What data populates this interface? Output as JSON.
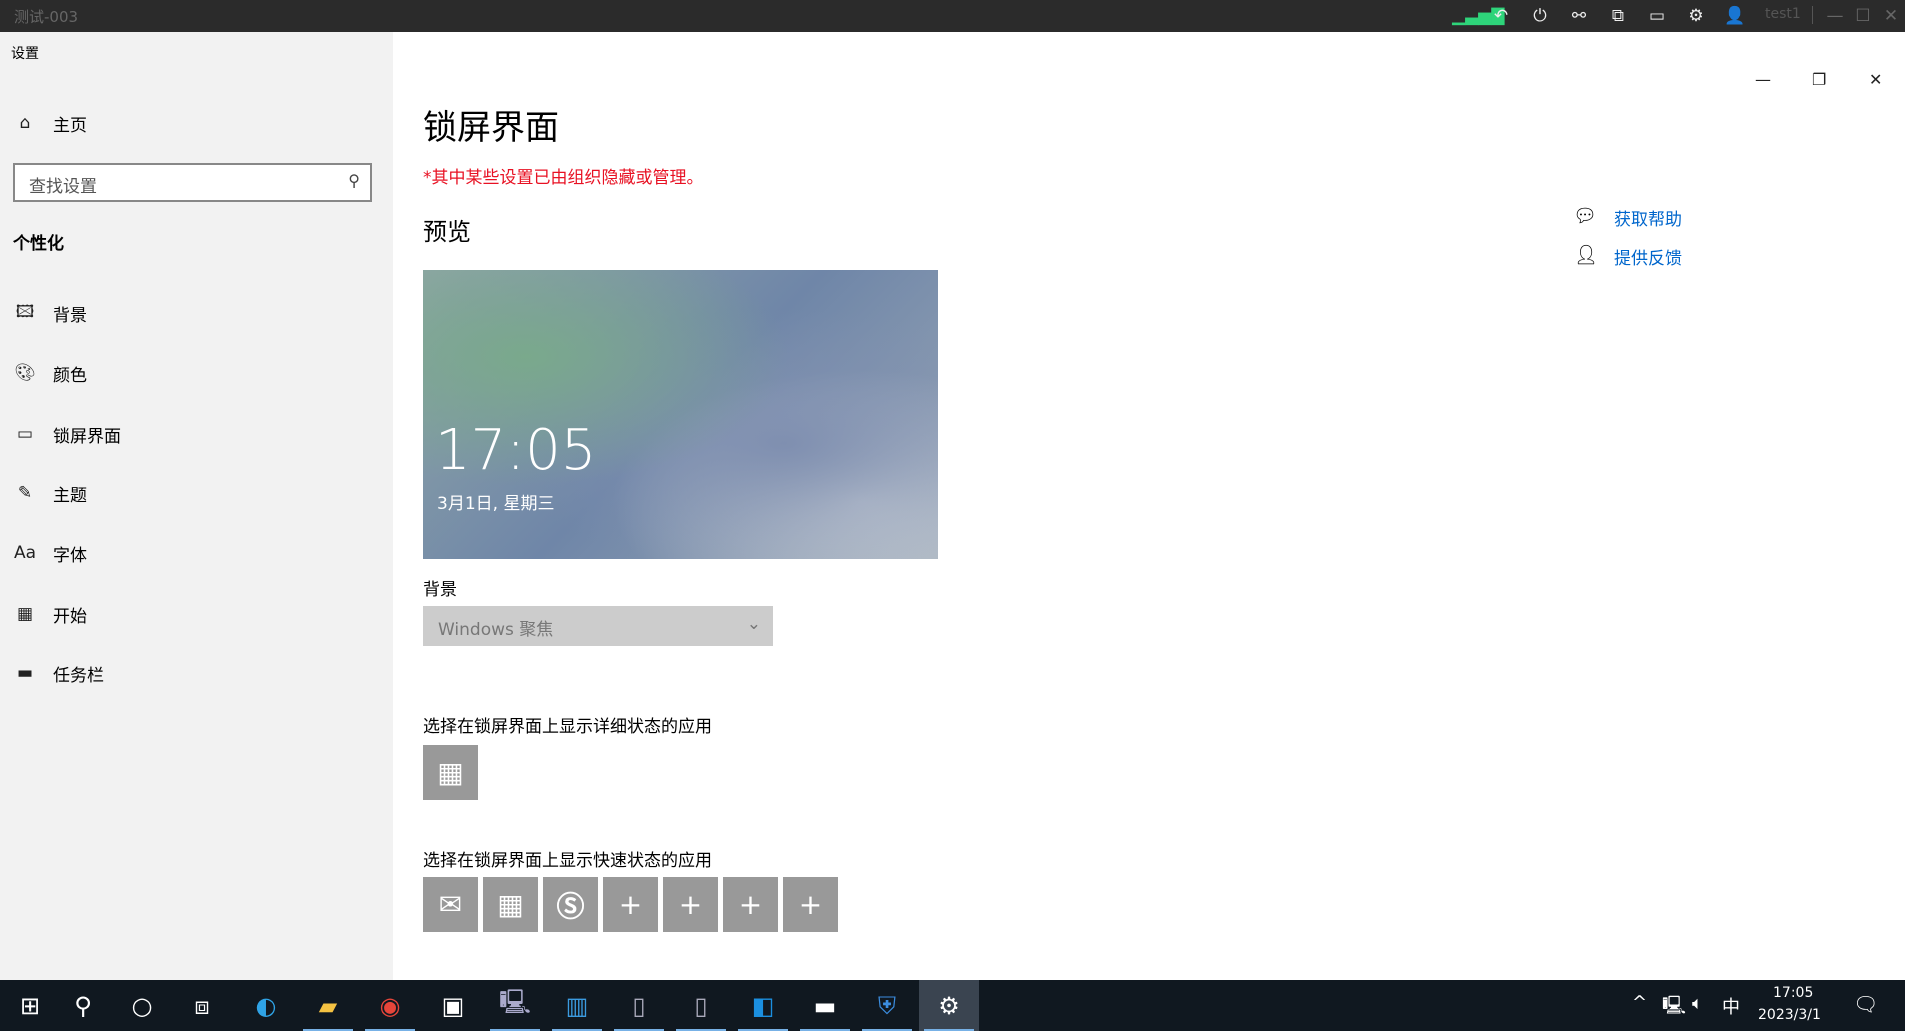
{
  "topbar": {
    "title": "测试-003",
    "user": "test1"
  },
  "window": {
    "app_title": "设置"
  },
  "sidebar": {
    "home": "主页",
    "search_placeholder": "查找设置",
    "section": "个性化",
    "items": [
      {
        "label": "背景",
        "icon": "picture-icon"
      },
      {
        "label": "颜色",
        "icon": "palette-icon"
      },
      {
        "label": "锁屏界面",
        "icon": "lockscreen-icon"
      },
      {
        "label": "主题",
        "icon": "theme-icon"
      },
      {
        "label": "字体",
        "icon": "font-icon"
      },
      {
        "label": "开始",
        "icon": "start-icon"
      },
      {
        "label": "任务栏",
        "icon": "taskbar-icon"
      }
    ]
  },
  "main": {
    "title": "锁屏界面",
    "notice": "*其中某些设置已由组织隐藏或管理。",
    "preview_heading": "预览",
    "preview_time": "17:05",
    "preview_date": "3月1日, 星期三",
    "background_label": "背景",
    "background_value": "Windows 聚焦",
    "detail_label": "选择在锁屏界面上显示详细状态的应用",
    "quick_label": "选择在锁屏界面上显示快速状态的应用",
    "help": "获取帮助",
    "feedback": "提供反馈"
  },
  "taskbar": {
    "time": "17:05",
    "date": "2023/3/1",
    "ime": "中"
  },
  "colors": {
    "accent": "#0066cc",
    "notice": "#e81123",
    "tile": "#999999"
  }
}
